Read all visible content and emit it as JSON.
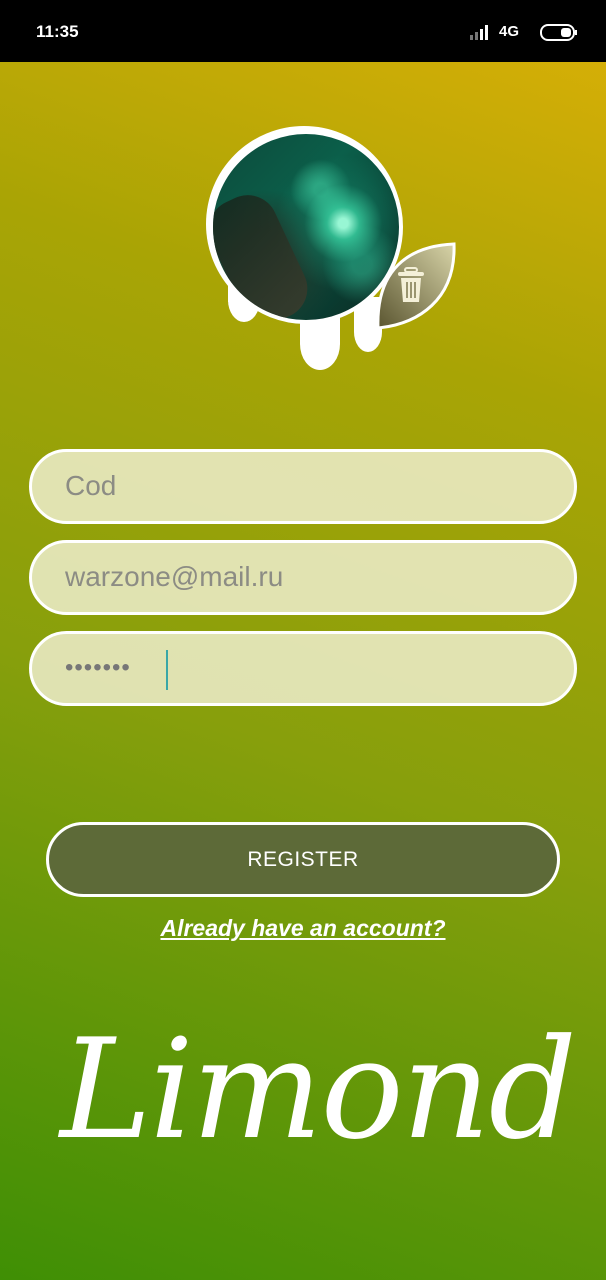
{
  "status_bar": {
    "time": "11:35",
    "network": "4G",
    "icons": [
      "signal-icon",
      "battery-icon"
    ]
  },
  "avatar": {
    "action_icon": "trash-icon"
  },
  "form": {
    "name_value": "Cod",
    "email_value": "warzone@mail.ru",
    "password_value": "•••••••"
  },
  "actions": {
    "register_label": "REGISTER",
    "login_link": "Already have an account?"
  },
  "brand": {
    "logo_text": "Limond"
  },
  "colors": {
    "gradient_top": "#dcb007",
    "gradient_bottom": "#3f8f05",
    "field_bg": "#ececc8",
    "button_bg": "#5d6a38",
    "caret": "#3aa7a7"
  }
}
